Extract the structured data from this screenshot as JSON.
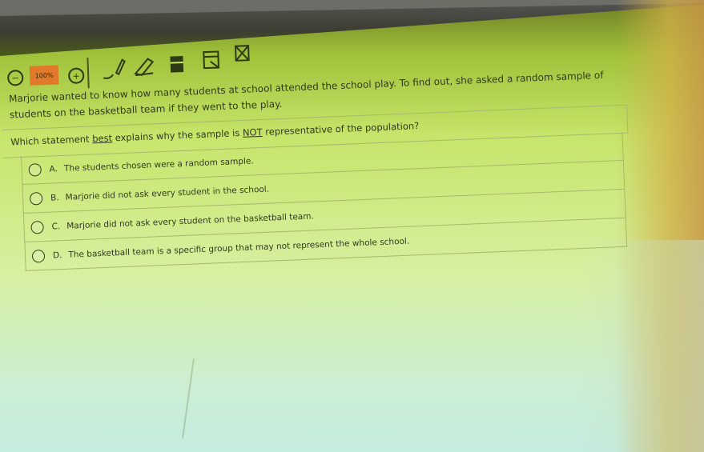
{
  "toolbar": {
    "zoom_out_symbol": "−",
    "zoom_level": "100%",
    "zoom_in_symbol": "+",
    "tools": [
      "pencil-icon",
      "eraser-icon",
      "highlighter-icon",
      "line-reader-icon",
      "eliminate-choice-icon"
    ]
  },
  "question": {
    "stem": "Marjorie wanted to know how many students at school attended the school play. To find out, she asked a random sample of students on the basketball team if they went to the play.",
    "prompt_before": "Which statement ",
    "prompt_best": "best",
    "prompt_middle": " explains why the sample is ",
    "prompt_not": "NOT",
    "prompt_after": " representative of the population?"
  },
  "choices": [
    {
      "letter": "A.",
      "text": "The students chosen were a random sample."
    },
    {
      "letter": "B.",
      "text": "Marjorie did not ask every student in the school."
    },
    {
      "letter": "C.",
      "text": "Marjorie did not ask every student on the basketball team."
    },
    {
      "letter": "D.",
      "text": "The basketball team is a specific group that may not represent the whole school."
    }
  ],
  "colors": {
    "screen_tint": "#c6e56a",
    "zoom_badge": "#e07a2a",
    "text": "#303a1e"
  }
}
